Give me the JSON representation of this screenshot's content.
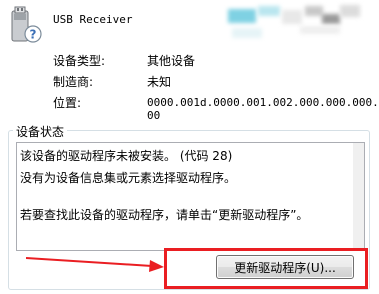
{
  "device": {
    "name": "USB Receiver",
    "icon": "usb-unknown-device-icon"
  },
  "properties": {
    "type_label": "设备类型:",
    "type_value": "其他设备",
    "manufacturer_label": "制造商:",
    "manufacturer_value": "未知",
    "location_label": "位置:",
    "location_value_line1": "0000.001d.0000.001.002.000.000.000.0",
    "location_value_line2": "00"
  },
  "status": {
    "group_title": "设备状态",
    "line1": "该设备的驱动程序未被安装。 (代码 28)",
    "line2": "没有为设备信息集或元素选择驱动程序。",
    "line3": "若要查找此设备的驱动程序，请单击“更新驱动程序”。"
  },
  "actions": {
    "update_driver_label": "更新驱动程序(U)..."
  },
  "colors": {
    "highlight": "#ea1e22",
    "group_border": "#d5dfe5",
    "button_border": "#707070"
  }
}
